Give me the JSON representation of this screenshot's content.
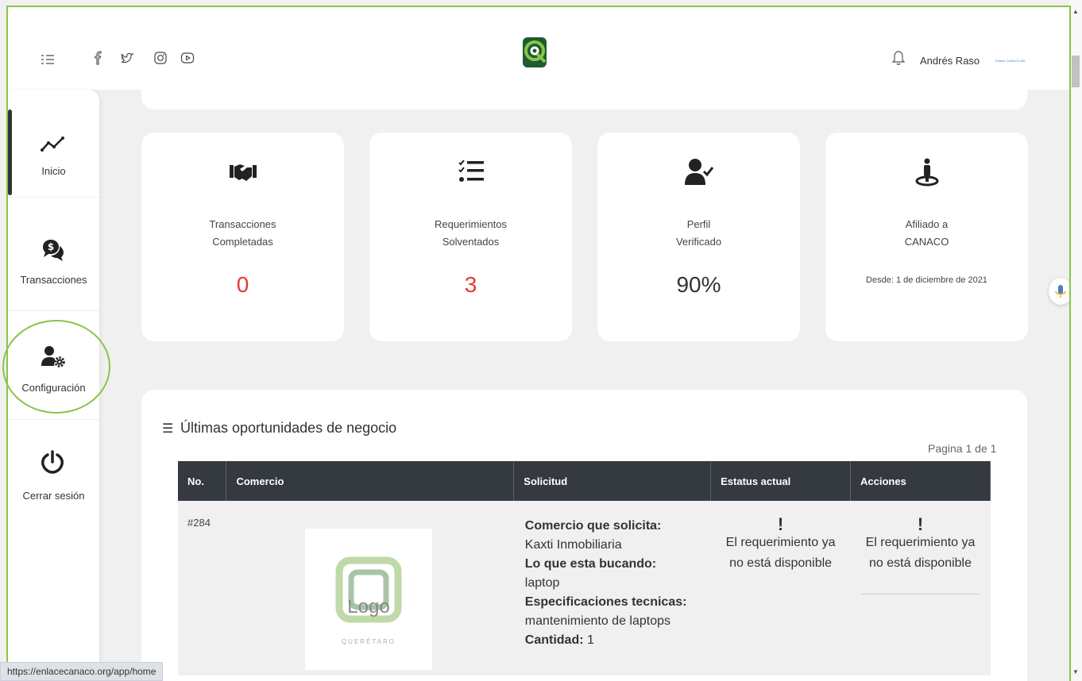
{
  "header": {
    "user_name": "Andrés Raso",
    "user_tag": "Enlace CANACO MX"
  },
  "sidebar": {
    "items": [
      {
        "label": "Inicio",
        "icon": "trend-line-icon"
      },
      {
        "label": "Transacciones",
        "icon": "dollar-chat-icon"
      },
      {
        "label": "Configuración",
        "icon": "user-gear-icon"
      },
      {
        "label": "Cerrar sesión",
        "icon": "power-icon"
      }
    ]
  },
  "stats": [
    {
      "label_line1": "Transacciones",
      "label_line2": "Completadas",
      "value": "0",
      "icon": "handshake-icon"
    },
    {
      "label_line1": "Requerimientos",
      "label_line2": "Solventados",
      "value": "3",
      "icon": "checklist-icon"
    },
    {
      "label_line1": "Perfil",
      "label_line2": "Verificado",
      "value": "90%",
      "icon": "user-check-icon"
    },
    {
      "label_line1": "Afiliado a",
      "label_line2": "CANACO",
      "date": "Desde: 1 de diciembre de 2021",
      "icon": "person-pin-icon"
    }
  ],
  "opportunities": {
    "title": "Últimas oportunidades de negocio",
    "pagination": "Pagina 1 de 1",
    "columns": [
      "No.",
      "Comercio",
      "Solicitud",
      "Estatus actual",
      "Acciones"
    ],
    "rows": [
      {
        "no": "#284",
        "logo_text": "Logo",
        "logo_sub": "QUERÉTARO",
        "solicita_label": "Comercio que solicita:",
        "solicita_value": "Kaxti Inmobiliaria",
        "busca_label": "Lo que esta bucando:",
        "busca_value": "laptop",
        "specs_label": "Especificaciones tecnicas:",
        "specs_value": "mantenimiento de laptops",
        "cantidad_label": "Cantidad:",
        "cantidad_value": "1",
        "status": "El requerimiento ya no está disponible",
        "action": "El requerimiento ya no está disponible"
      }
    ]
  },
  "status_url": "https://enlacecanaco.org/app/home",
  "colors": {
    "accent_green": "#8bc34a",
    "value_red": "#e53935",
    "table_header": "#343a40"
  }
}
